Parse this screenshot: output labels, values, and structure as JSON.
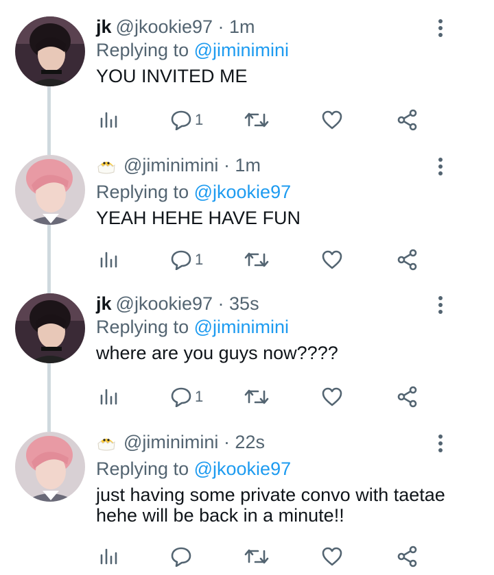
{
  "colors": {
    "accent": "#1d9bf0",
    "muted": "#536471",
    "text": "#0f1419",
    "thread": "#cfd9de"
  },
  "tweets": [
    {
      "name": "jk",
      "handle": "@jkookie97",
      "time": "· 1m",
      "reply_prefix": "Replying to",
      "reply_to": "@jiminimini",
      "text": "YOU INVITED ME",
      "reply_count": "1",
      "avatar": "jk-avatar"
    },
    {
      "name": "",
      "emoji": "chick-emoji",
      "handle": "@jiminimini",
      "time": "· 1m",
      "reply_prefix": "Replying to",
      "reply_to": "@jkookie97",
      "text": "YEAH HEHE HAVE FUN",
      "reply_count": "1",
      "avatar": "jimin-avatar"
    },
    {
      "name": "jk",
      "handle": "@jkookie97",
      "time": "· 35s",
      "reply_prefix": "Replying to",
      "reply_to": "@jiminimini",
      "text": "where are you guys now????",
      "reply_count": "1",
      "avatar": "jk-avatar"
    },
    {
      "name": "",
      "emoji": "chick-emoji",
      "handle": "@jiminimini",
      "time": "· 22s",
      "reply_prefix": "Replying to",
      "reply_to": "@jkookie97",
      "text": "just having some private convo with taetae hehe will be back in a minute!!",
      "reply_count": "",
      "avatar": "jimin-avatar"
    }
  ]
}
